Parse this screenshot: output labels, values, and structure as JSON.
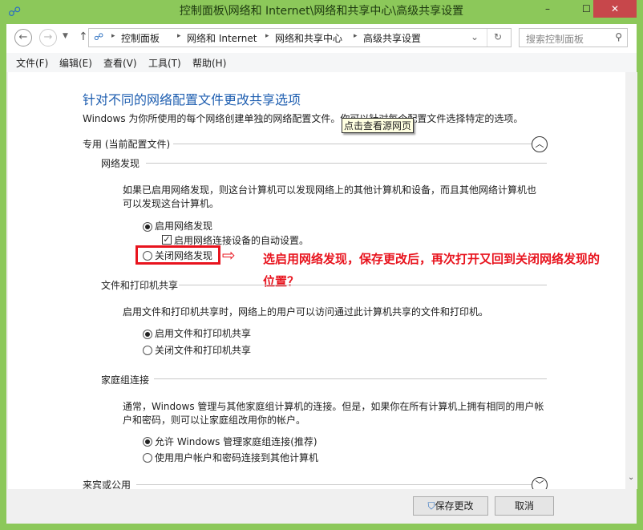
{
  "colors": {
    "border": "#8cc85a",
    "accent": "#1e5eb0",
    "annotation": "#e8141e"
  },
  "window": {
    "title": "控制面板\\网络和 Internet\\网络和共享中心\\高级共享设置",
    "close": "✕",
    "max": "☐",
    "min": "–"
  },
  "address": {
    "crumbs": [
      "控制面板",
      "网络和 Internet",
      "网络和共享中心",
      "高级共享设置"
    ],
    "search_placeholder": "搜索控制面板"
  },
  "menu": [
    "文件(F)",
    "编辑(E)",
    "查看(V)",
    "工具(T)",
    "帮助(H)"
  ],
  "main": {
    "heading": "针对不同的网络配置文件更改共享选项",
    "intro": "Windows 为你所使用的每个网络创建单独的网络配置文件。你可以针对每个配置文件选择特定的选项。",
    "tooltip": "点击查看源网页",
    "profile_private": "专用 (当前配置文件)",
    "discovery": {
      "title": "网络发现",
      "desc1": "如果已启用网络发现，则这台计算机可以发现网络上的其他计算机和设备，而且其他网络计算机也",
      "desc2": "可以发现这台计算机。",
      "on": "启用网络发现",
      "auto": "启用网络连接设备的自动设置。",
      "off": "关闭网络发现"
    },
    "annotation1": "选启用网络发现，保存更改后，再次打开又回到关闭网络发现的",
    "annotation2": "位置？",
    "files": {
      "title": "文件和打印机共享",
      "desc": "启用文件和打印机共享时，网络上的用户可以访问通过此计算机共享的文件和打印机。",
      "on": "启用文件和打印机共享",
      "off": "关闭文件和打印机共享"
    },
    "homegroup": {
      "title": "家庭组连接",
      "desc1": "通常，Windows 管理与其他家庭组计算机的连接。但是，如果你在所有计算机上拥有相同的用户帐",
      "desc2": "户和密码，则可以让家庭组改用你的帐户。",
      "allow": "允许 Windows 管理家庭组连接(推荐)",
      "use": "使用用户帐户和密码连接到其他计算机"
    },
    "profile_guest": "来宾或公用"
  },
  "footer": {
    "save": "保存更改",
    "cancel": "取消"
  }
}
